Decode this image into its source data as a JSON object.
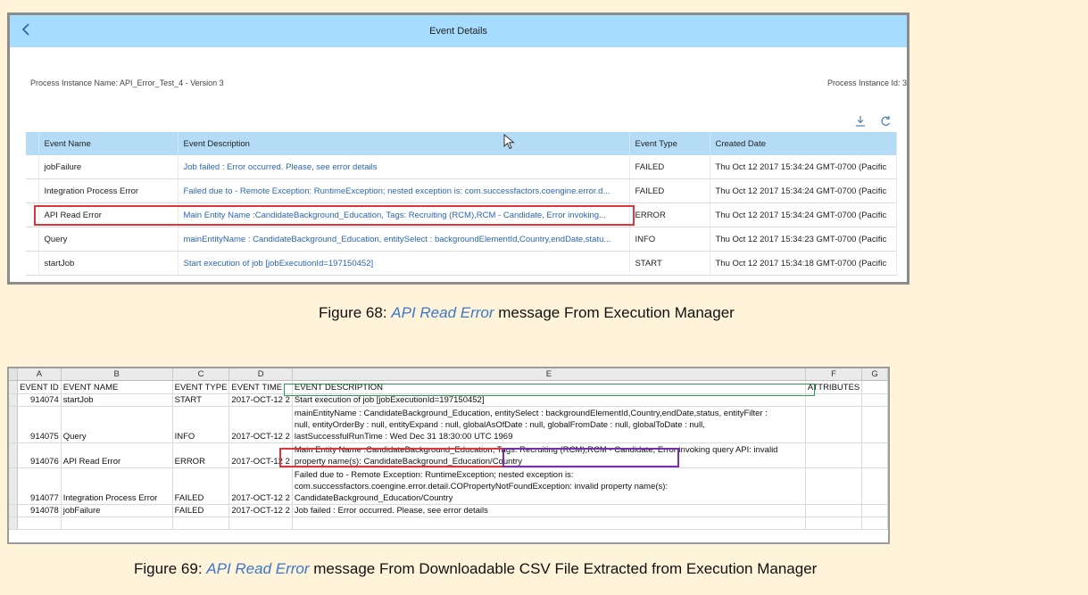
{
  "figure1": {
    "shell_title": "Event Details",
    "process_instance_name": "Process Instance Name: API_Error_Test_4 - Version 3",
    "process_instance_id": "Process Instance Id: 3",
    "columns": [
      "Event Name",
      "Event Description",
      "Event Type",
      "Created Date"
    ],
    "rows": [
      {
        "name": "jobFailure",
        "description": "Job failed : Error occurred. Please, see error details",
        "type": "FAILED",
        "date": "Thu Oct 12 2017 15:34:24 GMT-0700 (Pacific"
      },
      {
        "name": "Integration Process Error",
        "description": "Failed due to - Remote Exception: RuntimeException; nested exception is: com.successfactors.coengine.error.d...",
        "type": "FAILED",
        "date": "Thu Oct 12 2017 15:34:24 GMT-0700 (Pacific"
      },
      {
        "name": "API Read Error",
        "description": "Main Entity Name :CandidateBackground_Education, Tags: Recruiting (RCM),RCM - Candidate, Error invoking...",
        "type": "ERROR",
        "date": "Thu Oct 12 2017 15:34:24 GMT-0700 (Pacific"
      },
      {
        "name": "Query",
        "description": "mainEntityName : CandidateBackground_Education, entitySelect : backgroundElementId,Country,endDate,statu...",
        "type": "INFO",
        "date": "Thu Oct 12 2017 15:34:23 GMT-0700 (Pacific"
      },
      {
        "name": "startJob",
        "description": "Start execution of job [jobExecutionId=197150452]",
        "type": "START",
        "date": "Thu Oct 12 2017 15:34:18 GMT-0700 (Pacific"
      }
    ],
    "icons": {
      "back": "chevron-left-icon",
      "download": "download-icon",
      "refresh": "refresh-icon",
      "pointer": "mouse-pointer-icon"
    },
    "colors": {
      "shell_bar": "#a6dcff",
      "header_row": "#b5dcf6",
      "link": "#2a66b3",
      "highlight": "#e0343c"
    }
  },
  "caption1": {
    "prefix": "Figure 68: ",
    "emphasis": "API Read Error",
    "suffix": " message From Execution Manager"
  },
  "figure2": {
    "col_letters": [
      "A",
      "B",
      "C",
      "D",
      "E",
      "F",
      "G"
    ],
    "headers": [
      "EVENT ID",
      "EVENT NAME",
      "EVENT TYPE",
      "EVENT TIME",
      "EVENT DESCRIPTION",
      "ATTRIBUTES",
      ""
    ],
    "rows": [
      {
        "id": "914074",
        "name": "startJob",
        "type": "START",
        "time": "2017-OCT-12 2",
        "desc": [
          "Start execution of job [jobExecutionId=197150452]"
        ]
      },
      {
        "id": "914075",
        "name": "Query",
        "type": "INFO",
        "time": "2017-OCT-12 2",
        "desc": [
          "mainEntityName : CandidateBackground_Education, entitySelect : backgroundElementId,Country,endDate,status, entityFilter :",
          "null, entityOrderBy : null, entityExpand : null, globalAsOfDate : null, globalFromDate : null, globalToDate : null,",
          "lastSuccessfulRunTime : Wed Dec 31 18:30:00 UTC 1969"
        ]
      },
      {
        "id": "914076",
        "name": "API Read Error",
        "type": "ERROR",
        "time": "2017-OCT-12 2",
        "desc": [
          "Main Entity Name :CandidateBackground_Education, Tags: Recruiting (RCM),RCM - Candidate, Error invoking query API: invalid",
          "property name(s): CandidateBackground_Education/Country"
        ]
      },
      {
        "id": "914077",
        "name": "Integration Process Error",
        "type": "FAILED",
        "time": "2017-OCT-12 2",
        "desc": [
          "Failed due to - Remote Exception: RuntimeException; nested exception is:",
          "com.successfactors.coengine.error.detail.COPropertyNotFoundException: invalid property name(s):",
          "CandidateBackground_Education/Country"
        ]
      },
      {
        "id": "914078",
        "name": "jobFailure",
        "type": "FAILED",
        "time": "2017-OCT-12 2",
        "desc": [
          "Job failed : Error occurred. Please, see error details"
        ]
      }
    ],
    "colors": {
      "header_box": "#2e9b5d",
      "red_box": "#e0343c",
      "purple_box": "#7a2fb0"
    }
  },
  "caption2": {
    "prefix": "Figure 69: ",
    "emphasis": "API Read Error",
    "suffix": " message From Downloadable CSV File Extracted from Execution Manager"
  }
}
